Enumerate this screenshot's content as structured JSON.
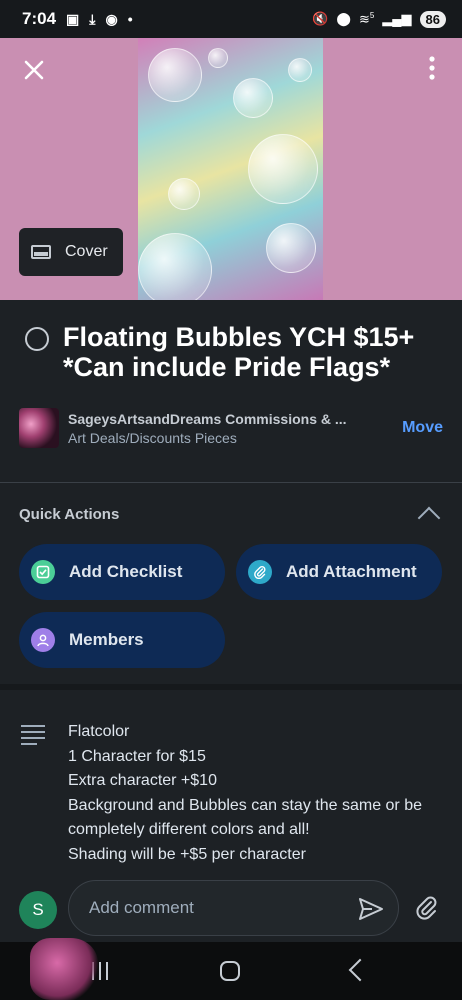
{
  "status_bar": {
    "time": "7:04",
    "battery": "86",
    "signal_label": "5"
  },
  "cover_button_label": "Cover",
  "card": {
    "title": "Floating Bubbles YCH $15+ *Can include Pride Flags*",
    "board_name": "SageysArtsandDreams Commissions & ...",
    "list_name": "Art Deals/Discounts Pieces",
    "move_label": "Move"
  },
  "quick_actions": {
    "title": "Quick Actions",
    "add_checklist": "Add Checklist",
    "add_attachment": "Add Attachment",
    "members": "Members",
    "colors": {
      "checklist": "#4bce97",
      "attachment": "#2ea9c9",
      "members": "#9f7fe8"
    }
  },
  "description": [
    "Flatcolor",
    "1 Character for $15",
    "Extra character +$10",
    "Background and Bubbles can stay the same or be completely different colors and all!",
    "Shading will be +$5 per character"
  ],
  "comment": {
    "avatar_initial": "S",
    "placeholder": "Add comment"
  },
  "colors": {
    "accent": "#579dff",
    "pill_bg": "#0e2a55",
    "background": "#1d2125",
    "avatar": "#1f845a"
  }
}
